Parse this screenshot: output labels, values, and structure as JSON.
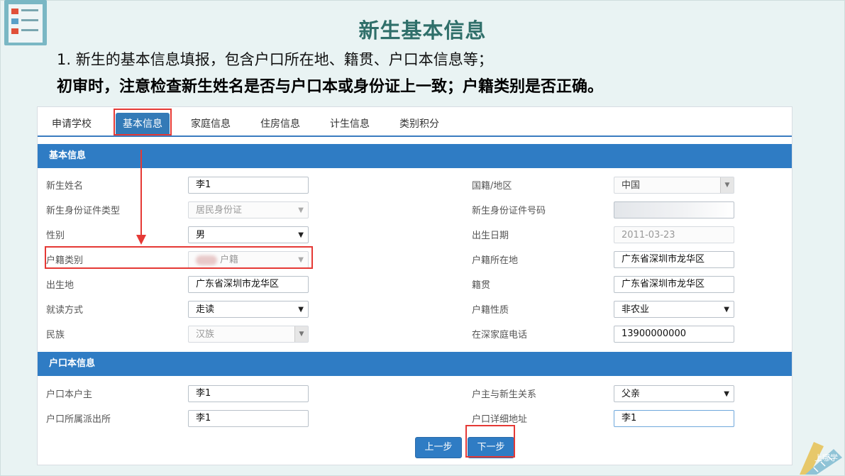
{
  "header": {
    "title": "新生基本信息",
    "line1": "1. 新生的基本信息填报，包含户口所在地、籍贯、户口本信息等；",
    "line2": "初审时，注意检查新生姓名是否与户口本或身份证上一致；户籍类别是否正确。"
  },
  "tabs": [
    {
      "label": "申请学校",
      "active": false
    },
    {
      "label": "基本信息",
      "active": true
    },
    {
      "label": "家庭信息",
      "active": false
    },
    {
      "label": "住房信息",
      "active": false
    },
    {
      "label": "计生信息",
      "active": false
    },
    {
      "label": "类别积分",
      "active": false
    }
  ],
  "basic_section": {
    "title": "基本信息",
    "left": [
      {
        "label": "新生姓名",
        "value": "李1"
      },
      {
        "label": "新生身份证件类型",
        "value": "居民身份证"
      },
      {
        "label": "性别",
        "value": "男"
      },
      {
        "label": "户籍类别",
        "value": "户籍"
      },
      {
        "label": "出生地",
        "value": "广东省深圳市龙华区"
      },
      {
        "label": "就读方式",
        "value": "走读"
      },
      {
        "label": "民族",
        "value": "汉族"
      }
    ],
    "right": [
      {
        "label": "国籍/地区",
        "value": "中国"
      },
      {
        "label": "新生身份证件号码",
        "value": ""
      },
      {
        "label": "出生日期",
        "value": "2011-03-23"
      },
      {
        "label": "户籍所在地",
        "value": "广东省深圳市龙华区"
      },
      {
        "label": "籍贯",
        "value": "广东省深圳市龙华区"
      },
      {
        "label": "户籍性质",
        "value": "非农业"
      },
      {
        "label": "在深家庭电话",
        "value": "13900000000"
      }
    ]
  },
  "hukou_section": {
    "title": "户口本信息",
    "left": [
      {
        "label": "户口本户主",
        "value": "李1"
      },
      {
        "label": "户口所属派出所",
        "value": "李1"
      }
    ],
    "right": [
      {
        "label": "户主与新生关系",
        "value": "父亲"
      },
      {
        "label": "户口详细地址",
        "value": "李1"
      }
    ]
  },
  "buttons": {
    "prev": "上一步",
    "next": "下一步"
  },
  "watermark": "上哪学",
  "colors": {
    "accent": "#2f7cc4",
    "highlight": "#e53935",
    "title": "#2f6f6a"
  }
}
